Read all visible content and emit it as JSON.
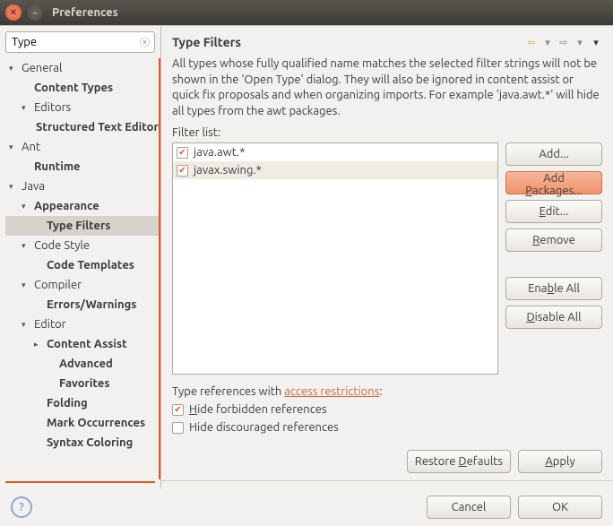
{
  "window": {
    "title": "Preferences"
  },
  "sidebar": {
    "search_value": "Type",
    "items": [
      {
        "level": 1,
        "arrow": "▾",
        "label": "General",
        "bold": false
      },
      {
        "level": 2,
        "arrow": "",
        "label": "Content Types",
        "bold": true
      },
      {
        "level": 2,
        "arrow": "▾",
        "label": "Editors",
        "bold": false
      },
      {
        "level": 3,
        "arrow": "",
        "label": "Structured Text Editors",
        "bold": true
      },
      {
        "level": 1,
        "arrow": "▾",
        "label": "Ant",
        "bold": false
      },
      {
        "level": 2,
        "arrow": "",
        "label": "Runtime",
        "bold": true
      },
      {
        "level": 1,
        "arrow": "▾",
        "label": "Java",
        "bold": false
      },
      {
        "level": 2,
        "arrow": "▾",
        "label": "Appearance",
        "bold": true
      },
      {
        "level": 3,
        "arrow": "",
        "label": "Type Filters",
        "bold": true,
        "selected": true
      },
      {
        "level": 2,
        "arrow": "▾",
        "label": "Code Style",
        "bold": false
      },
      {
        "level": 3,
        "arrow": "",
        "label": "Code Templates",
        "bold": true
      },
      {
        "level": 2,
        "arrow": "▾",
        "label": "Compiler",
        "bold": false
      },
      {
        "level": 3,
        "arrow": "",
        "label": "Errors/Warnings",
        "bold": true
      },
      {
        "level": 2,
        "arrow": "▾",
        "label": "Editor",
        "bold": false
      },
      {
        "level": 3,
        "arrow": "▸",
        "label": "Content Assist",
        "bold": true
      },
      {
        "level": 4,
        "arrow": "",
        "label": "Advanced",
        "bold": true
      },
      {
        "level": 4,
        "arrow": "",
        "label": "Favorites",
        "bold": true
      },
      {
        "level": 3,
        "arrow": "",
        "label": "Folding",
        "bold": true
      },
      {
        "level": 3,
        "arrow": "",
        "label": "Mark Occurrences",
        "bold": true
      },
      {
        "level": 3,
        "arrow": "",
        "label": "Syntax Coloring",
        "bold": true
      }
    ]
  },
  "main": {
    "title": "Type Filters",
    "description": "All types whose fully qualified name matches the selected filter strings will not be shown in the 'Open Type' dialog. They will also be ignored in content assist or quick fix proposals and when organizing imports. For example 'java.awt.*' will hide all types from the awt packages.",
    "filter_list_label": "Filter list:",
    "filters": [
      {
        "checked": true,
        "label": "java.awt.*",
        "selected": false
      },
      {
        "checked": true,
        "label": "javax.swing.*",
        "selected": true
      }
    ],
    "buttons": {
      "add": "Add...",
      "add_packages": "Add Packages...",
      "edit": "Edit...",
      "remove": "Remove",
      "enable_all": "Enable All",
      "disable_all": "Disable All"
    },
    "refs_prefix": "Type references with ",
    "refs_link": "access restrictions",
    "refs_suffix": ":",
    "hide_forbidden": {
      "checked": true,
      "label": "Hide forbidden references"
    },
    "hide_discouraged": {
      "checked": false,
      "label": "Hide discouraged references"
    },
    "restore_defaults": "Restore Defaults",
    "apply": "Apply"
  },
  "footer": {
    "cancel": "Cancel",
    "ok": "OK"
  }
}
